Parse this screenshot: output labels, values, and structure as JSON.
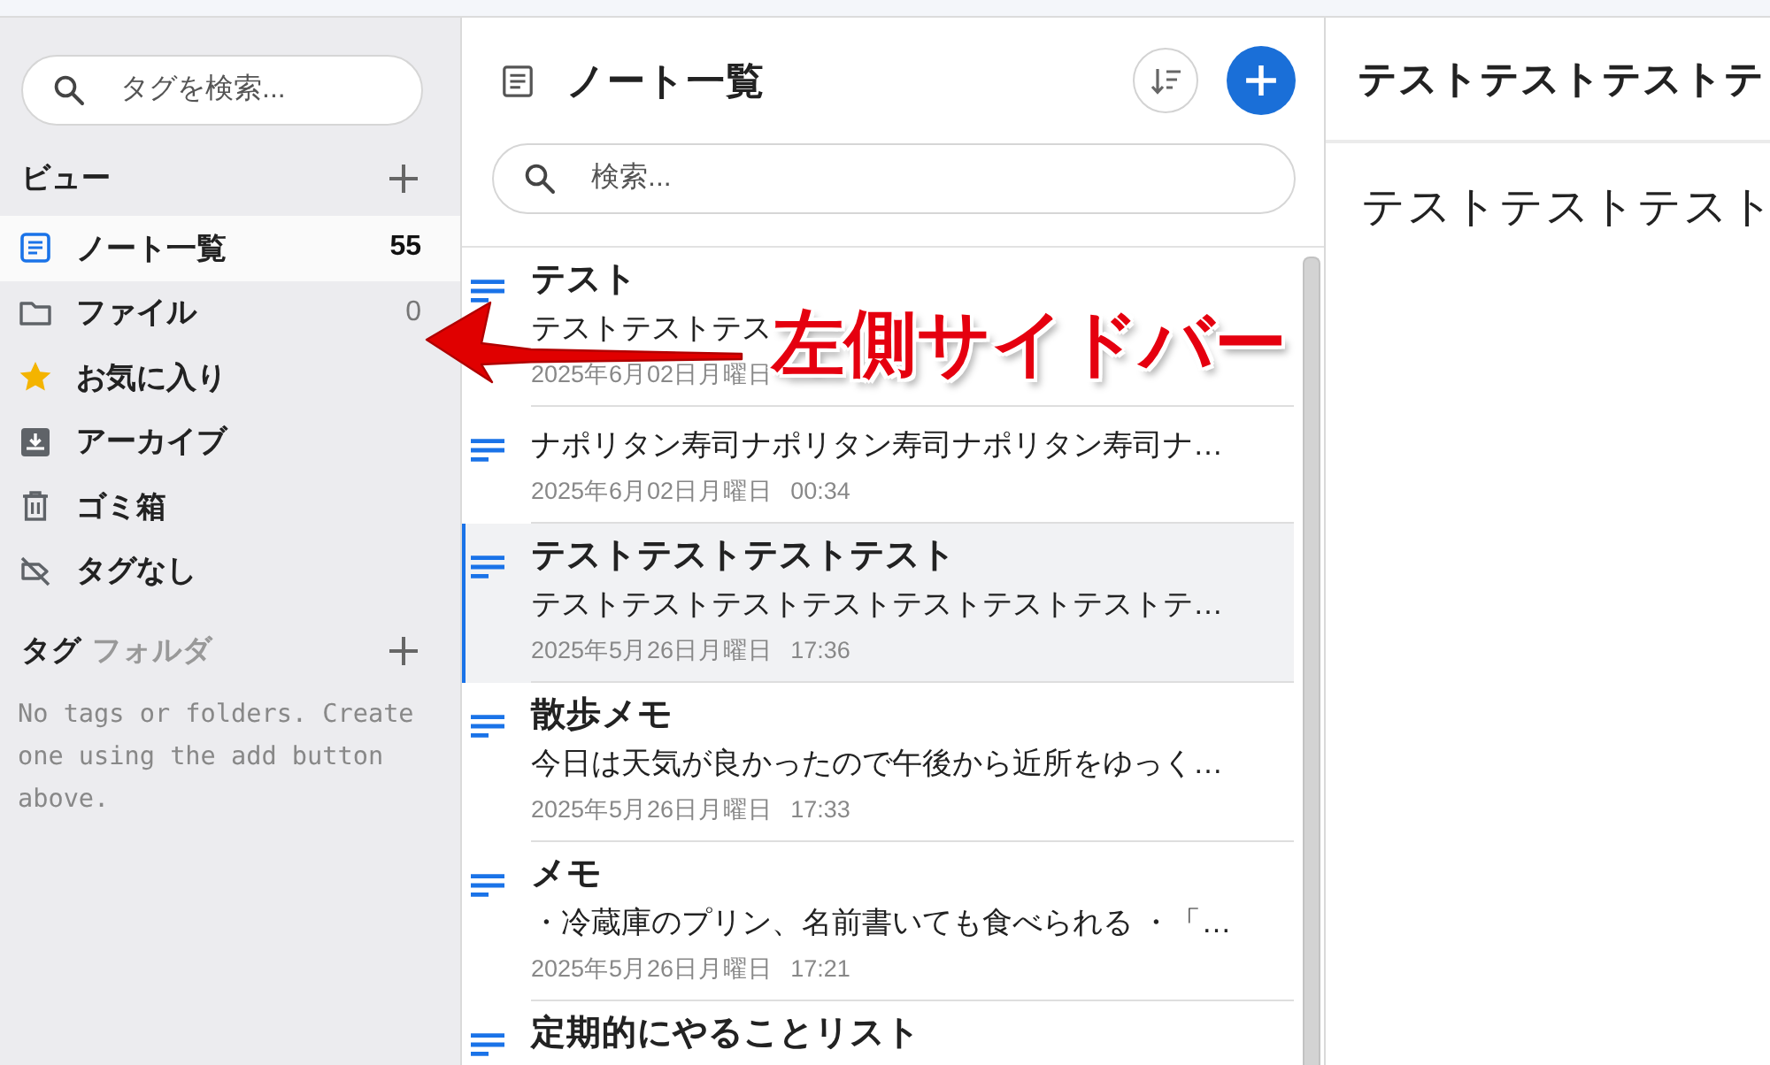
{
  "sidebar": {
    "search": {
      "placeholder": "タグを検索..."
    },
    "views_heading": "ビュー",
    "views": [
      {
        "kind": "notes",
        "label": "ノート一覧",
        "count": "55",
        "selected": true
      },
      {
        "kind": "folder",
        "label": "ファイル",
        "count": "0",
        "selected": false
      },
      {
        "kind": "favorites",
        "label": "お気に入り",
        "selected": false
      },
      {
        "kind": "archive",
        "label": "アーカイブ",
        "selected": false
      },
      {
        "kind": "trash",
        "label": "ゴミ箱",
        "selected": false
      },
      {
        "kind": "untagged",
        "label": "タグなし",
        "selected": false
      }
    ],
    "tag_tabs": [
      {
        "label": "タグ",
        "selected": true
      },
      {
        "label": "フォルダ",
        "selected": false
      }
    ],
    "empty_message": "No tags or folders. Create one using the add button above."
  },
  "note_list": {
    "title": "ノート一覧",
    "search": {
      "placeholder": "検索..."
    },
    "notes": [
      {
        "title": "テスト",
        "preview": "テストテストテス",
        "date": "2025年6月02日月曜日",
        "selected": false
      },
      {
        "preview": "ナポリタン寿司ナポリタン寿司ナポリタン寿司ナ…",
        "date": "2025年6月02日月曜日",
        "time": "00:34",
        "selected": false
      },
      {
        "title": "テストテストテストテスト",
        "preview": "テストテストテストテストテストテストテストテ…",
        "date": "2025年5月26日月曜日",
        "time": "17:36",
        "selected": true
      },
      {
        "title": "散歩メモ",
        "preview": "今日は天気が良かったので午後から近所をゆっく…",
        "date": "2025年5月26日月曜日",
        "time": "17:33",
        "selected": false
      },
      {
        "title": "メモ",
        "preview": "・冷蔵庫のプリン、名前書いても食べられる ・「…",
        "date": "2025年5月26日月曜日",
        "time": "17:21",
        "selected": false
      },
      {
        "title": "定期的にやることリスト",
        "selected": false
      }
    ]
  },
  "editor": {
    "title": "テストテストテストテ",
    "body": "テストテストテスト"
  },
  "callout": {
    "label": "左側サイドバー"
  }
}
